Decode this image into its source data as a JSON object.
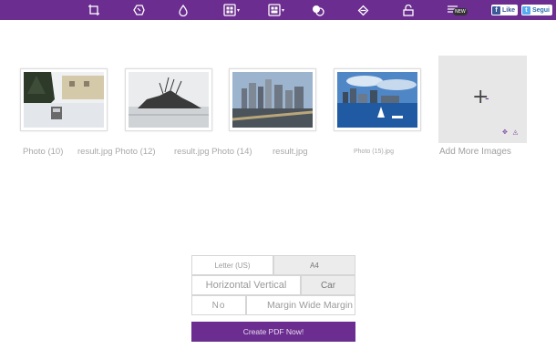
{
  "toolbar": {
    "icons": [
      "crop-icon",
      "shape-icon",
      "drop-icon",
      "layout-icon",
      "grid-icon",
      "circles-icon",
      "eraser-icon",
      "text-icon",
      "stack-icon"
    ],
    "new_badge": "NEW",
    "facebook_label": "Like",
    "twitter_label": "Segui",
    "accent_color": "#6b2d8f"
  },
  "images": [
    {
      "caption": "Photo (10)"
    },
    {
      "caption": "result.jpg Photo (12)"
    },
    {
      "caption": "result.jpg Photo (14)"
    },
    {
      "caption": "result.jpg"
    },
    {
      "caption": "Photo (15).jpg"
    }
  ],
  "add_more": {
    "plus": "+",
    "minus": "-",
    "icons": "✥ ◬",
    "label": "Add More Images"
  },
  "options": {
    "letter": "Letter (US)",
    "a4": "A4",
    "orientation": "Horizontal Vertical",
    "car": "Car",
    "no": "No",
    "margin": "Margin Wide Margin"
  },
  "create_button": "Create PDF Now!"
}
